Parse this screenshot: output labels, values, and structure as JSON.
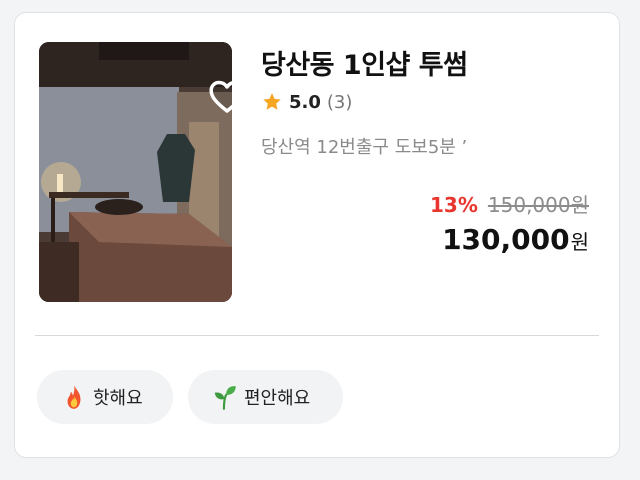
{
  "listing": {
    "title": "당산동 1인샵 투썸",
    "rating": "5.0",
    "review_count": "(3)",
    "location": "당산역 12번출구 도보5분 ’",
    "discount": "13%",
    "original_price": "150,000원",
    "final_price": "130,000",
    "final_currency": "원",
    "favorited": false
  },
  "tags": [
    {
      "label": "핫해요",
      "icon": "fire-icon"
    },
    {
      "label": "편안해요",
      "icon": "sprout-icon"
    }
  ],
  "colors": {
    "discount": "#e8362f",
    "star": "#f5a623",
    "tag_bg": "#f2f3f5"
  }
}
